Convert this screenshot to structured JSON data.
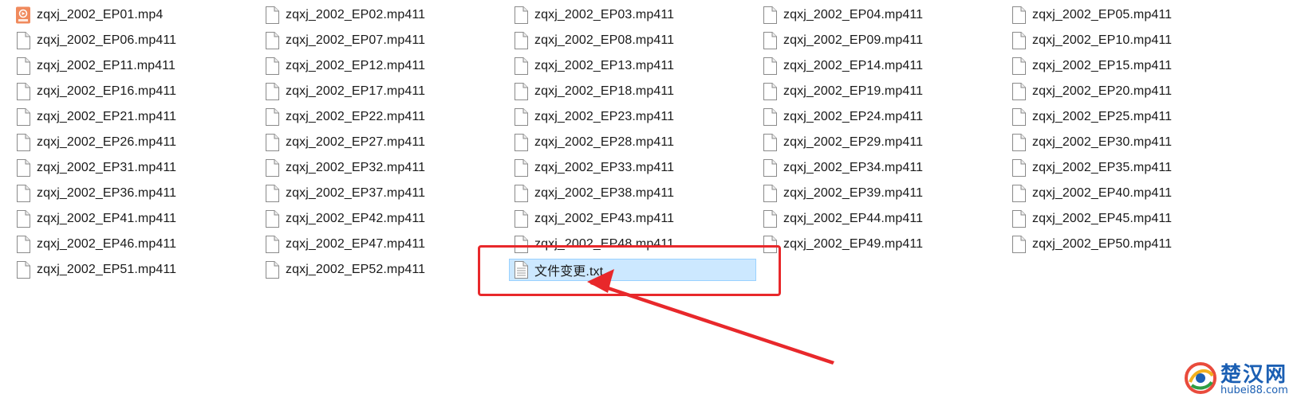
{
  "files": [
    {
      "name": "zqxj_2002_EP01.mp4",
      "type": "video"
    },
    {
      "name": "zqxj_2002_EP02.mp411",
      "type": "doc"
    },
    {
      "name": "zqxj_2002_EP03.mp411",
      "type": "doc"
    },
    {
      "name": "zqxj_2002_EP04.mp411",
      "type": "doc"
    },
    {
      "name": "zqxj_2002_EP05.mp411",
      "type": "doc"
    },
    {
      "name": "zqxj_2002_EP06.mp411",
      "type": "doc"
    },
    {
      "name": "zqxj_2002_EP07.mp411",
      "type": "doc"
    },
    {
      "name": "zqxj_2002_EP08.mp411",
      "type": "doc"
    },
    {
      "name": "zqxj_2002_EP09.mp411",
      "type": "doc"
    },
    {
      "name": "zqxj_2002_EP10.mp411",
      "type": "doc"
    },
    {
      "name": "zqxj_2002_EP11.mp411",
      "type": "doc"
    },
    {
      "name": "zqxj_2002_EP12.mp411",
      "type": "doc"
    },
    {
      "name": "zqxj_2002_EP13.mp411",
      "type": "doc"
    },
    {
      "name": "zqxj_2002_EP14.mp411",
      "type": "doc"
    },
    {
      "name": "zqxj_2002_EP15.mp411",
      "type": "doc"
    },
    {
      "name": "zqxj_2002_EP16.mp411",
      "type": "doc"
    },
    {
      "name": "zqxj_2002_EP17.mp411",
      "type": "doc"
    },
    {
      "name": "zqxj_2002_EP18.mp411",
      "type": "doc"
    },
    {
      "name": "zqxj_2002_EP19.mp411",
      "type": "doc"
    },
    {
      "name": "zqxj_2002_EP20.mp411",
      "type": "doc"
    },
    {
      "name": "zqxj_2002_EP21.mp411",
      "type": "doc"
    },
    {
      "name": "zqxj_2002_EP22.mp411",
      "type": "doc"
    },
    {
      "name": "zqxj_2002_EP23.mp411",
      "type": "doc"
    },
    {
      "name": "zqxj_2002_EP24.mp411",
      "type": "doc"
    },
    {
      "name": "zqxj_2002_EP25.mp411",
      "type": "doc"
    },
    {
      "name": "zqxj_2002_EP26.mp411",
      "type": "doc"
    },
    {
      "name": "zqxj_2002_EP27.mp411",
      "type": "doc"
    },
    {
      "name": "zqxj_2002_EP28.mp411",
      "type": "doc"
    },
    {
      "name": "zqxj_2002_EP29.mp411",
      "type": "doc"
    },
    {
      "name": "zqxj_2002_EP30.mp411",
      "type": "doc"
    },
    {
      "name": "zqxj_2002_EP31.mp411",
      "type": "doc"
    },
    {
      "name": "zqxj_2002_EP32.mp411",
      "type": "doc"
    },
    {
      "name": "zqxj_2002_EP33.mp411",
      "type": "doc"
    },
    {
      "name": "zqxj_2002_EP34.mp411",
      "type": "doc"
    },
    {
      "name": "zqxj_2002_EP35.mp411",
      "type": "doc"
    },
    {
      "name": "zqxj_2002_EP36.mp411",
      "type": "doc"
    },
    {
      "name": "zqxj_2002_EP37.mp411",
      "type": "doc"
    },
    {
      "name": "zqxj_2002_EP38.mp411",
      "type": "doc"
    },
    {
      "name": "zqxj_2002_EP39.mp411",
      "type": "doc"
    },
    {
      "name": "zqxj_2002_EP40.mp411",
      "type": "doc"
    },
    {
      "name": "zqxj_2002_EP41.mp411",
      "type": "doc"
    },
    {
      "name": "zqxj_2002_EP42.mp411",
      "type": "doc"
    },
    {
      "name": "zqxj_2002_EP43.mp411",
      "type": "doc"
    },
    {
      "name": "zqxj_2002_EP44.mp411",
      "type": "doc"
    },
    {
      "name": "zqxj_2002_EP45.mp411",
      "type": "doc"
    },
    {
      "name": "zqxj_2002_EP46.mp411",
      "type": "doc"
    },
    {
      "name": "zqxj_2002_EP47.mp411",
      "type": "doc"
    },
    {
      "name": "zqxj_2002_EP48.mp411",
      "type": "doc"
    },
    {
      "name": "zqxj_2002_EP49.mp411",
      "type": "doc"
    },
    {
      "name": "zqxj_2002_EP50.mp411",
      "type": "doc"
    },
    {
      "name": "zqxj_2002_EP51.mp411",
      "type": "doc"
    },
    {
      "name": "zqxj_2002_EP52.mp411",
      "type": "doc"
    },
    {
      "name": "文件变更.txt",
      "type": "doc",
      "selected": true
    }
  ],
  "annotation": {
    "color": "#e8282b"
  },
  "selection": {
    "background": "#cce8ff",
    "border": "#99d1ff"
  },
  "watermark": {
    "title": "楚汉网",
    "subtitle": "hubei88.com",
    "color": "#1b5fb3"
  },
  "icons": {
    "video": "video-file-icon",
    "doc": "document-file-icon"
  }
}
